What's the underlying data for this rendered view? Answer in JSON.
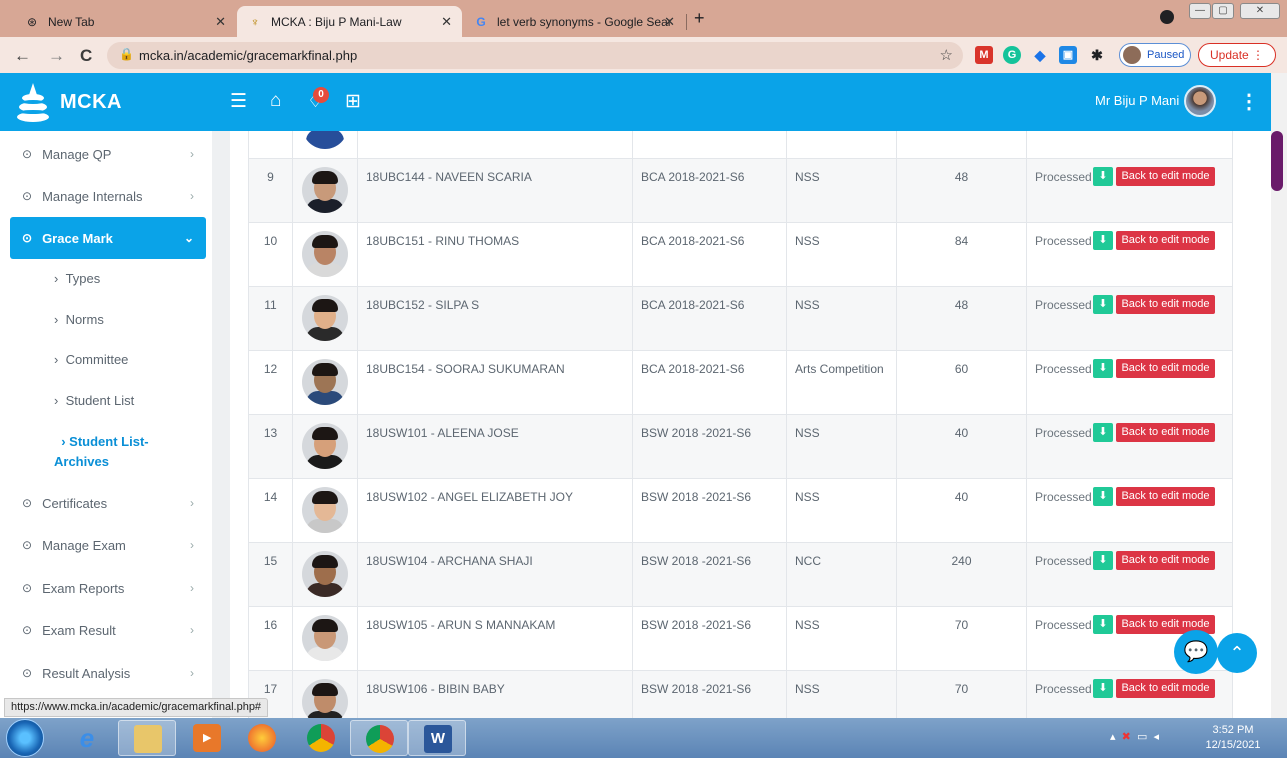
{
  "browser": {
    "tabs": [
      {
        "label": "New Tab",
        "icon": "chrome-newtab-icon",
        "active": false
      },
      {
        "label": "MCKA : Biju P Mani-Law",
        "icon": "mcka-favicon",
        "active": true
      },
      {
        "label": "let verb synonyms - Google Sear",
        "icon": "google-g-icon",
        "active": false
      }
    ],
    "url": "mcka.in/academic/gracemarkfinal.php",
    "profile_label": "Paused",
    "update_label": "Update"
  },
  "app": {
    "brand": "MCKA",
    "notification_count": "0",
    "user_name": "Mr Biju P Mani"
  },
  "sidebar": {
    "items": [
      {
        "label": "Manage QP"
      },
      {
        "label": "Manage Internals"
      },
      {
        "label": "Grace Mark",
        "active": true
      },
      {
        "label": "Certificates"
      },
      {
        "label": "Manage Exam"
      },
      {
        "label": "Exam Reports"
      },
      {
        "label": "Exam Result"
      },
      {
        "label": "Result Analysis"
      }
    ],
    "subitems": [
      {
        "label": "Types"
      },
      {
        "label": "Norms"
      },
      {
        "label": "Committee"
      },
      {
        "label": "Student List"
      },
      {
        "label": "Student List- Archives",
        "active": true
      }
    ]
  },
  "table": {
    "rows": [
      {
        "no": "9",
        "student": "18UBC144 - NAVEEN SCARIA",
        "course": "BCA 2018-2021-S6",
        "category": "NSS",
        "mark": "48",
        "status": "Processed",
        "action": "Back to edit mode"
      },
      {
        "no": "10",
        "student": "18UBC151 - RINU THOMAS",
        "course": "BCA 2018-2021-S6",
        "category": "NSS",
        "mark": "84",
        "status": "Processed",
        "action": "Back to edit mode"
      },
      {
        "no": "11",
        "student": "18UBC152 - SILPA S",
        "course": "BCA 2018-2021-S6",
        "category": "NSS",
        "mark": "48",
        "status": "Processed",
        "action": "Back to edit mode"
      },
      {
        "no": "12",
        "student": "18UBC154 - SOORAJ SUKUMARAN",
        "course": "BCA 2018-2021-S6",
        "category": "Arts Competition",
        "mark": "60",
        "status": "Processed",
        "action": "Back to edit mode"
      },
      {
        "no": "13",
        "student": "18USW101 - ALEENA JOSE",
        "course": "BSW 2018 -2021-S6",
        "category": "NSS",
        "mark": "40",
        "status": "Processed",
        "action": "Back to edit mode"
      },
      {
        "no": "14",
        "student": "18USW102 - ANGEL ELIZABETH JOY",
        "course": "BSW 2018 -2021-S6",
        "category": "NSS",
        "mark": "40",
        "status": "Processed",
        "action": "Back to edit mode"
      },
      {
        "no": "15",
        "student": "18USW104 - ARCHANA SHAJI",
        "course": "BSW 2018 -2021-S6",
        "category": "NCC",
        "mark": "240",
        "status": "Processed",
        "action": "Back to edit mode"
      },
      {
        "no": "16",
        "student": "18USW105 - ARUN S MANNAKAM",
        "course": "BSW 2018 -2021-S6",
        "category": "NSS",
        "mark": "70",
        "status": "Processed",
        "action": "Back to edit mode"
      },
      {
        "no": "17",
        "student": "18USW106 - BIBIN BABY",
        "course": "BSW 2018 -2021-S6",
        "category": "NSS",
        "mark": "70",
        "status": "Processed",
        "action": "Back to edit mode"
      }
    ]
  },
  "status_url": "https://www.mcka.in/academic/gracemarkfinal.php#",
  "taskbar": {
    "time": "3:52 PM",
    "date": "12/15/2021"
  },
  "colors": {
    "primary": "#0aa3e8",
    "danger": "#dc3545",
    "success": "#20c997",
    "tab_strip": "#d7a795"
  }
}
